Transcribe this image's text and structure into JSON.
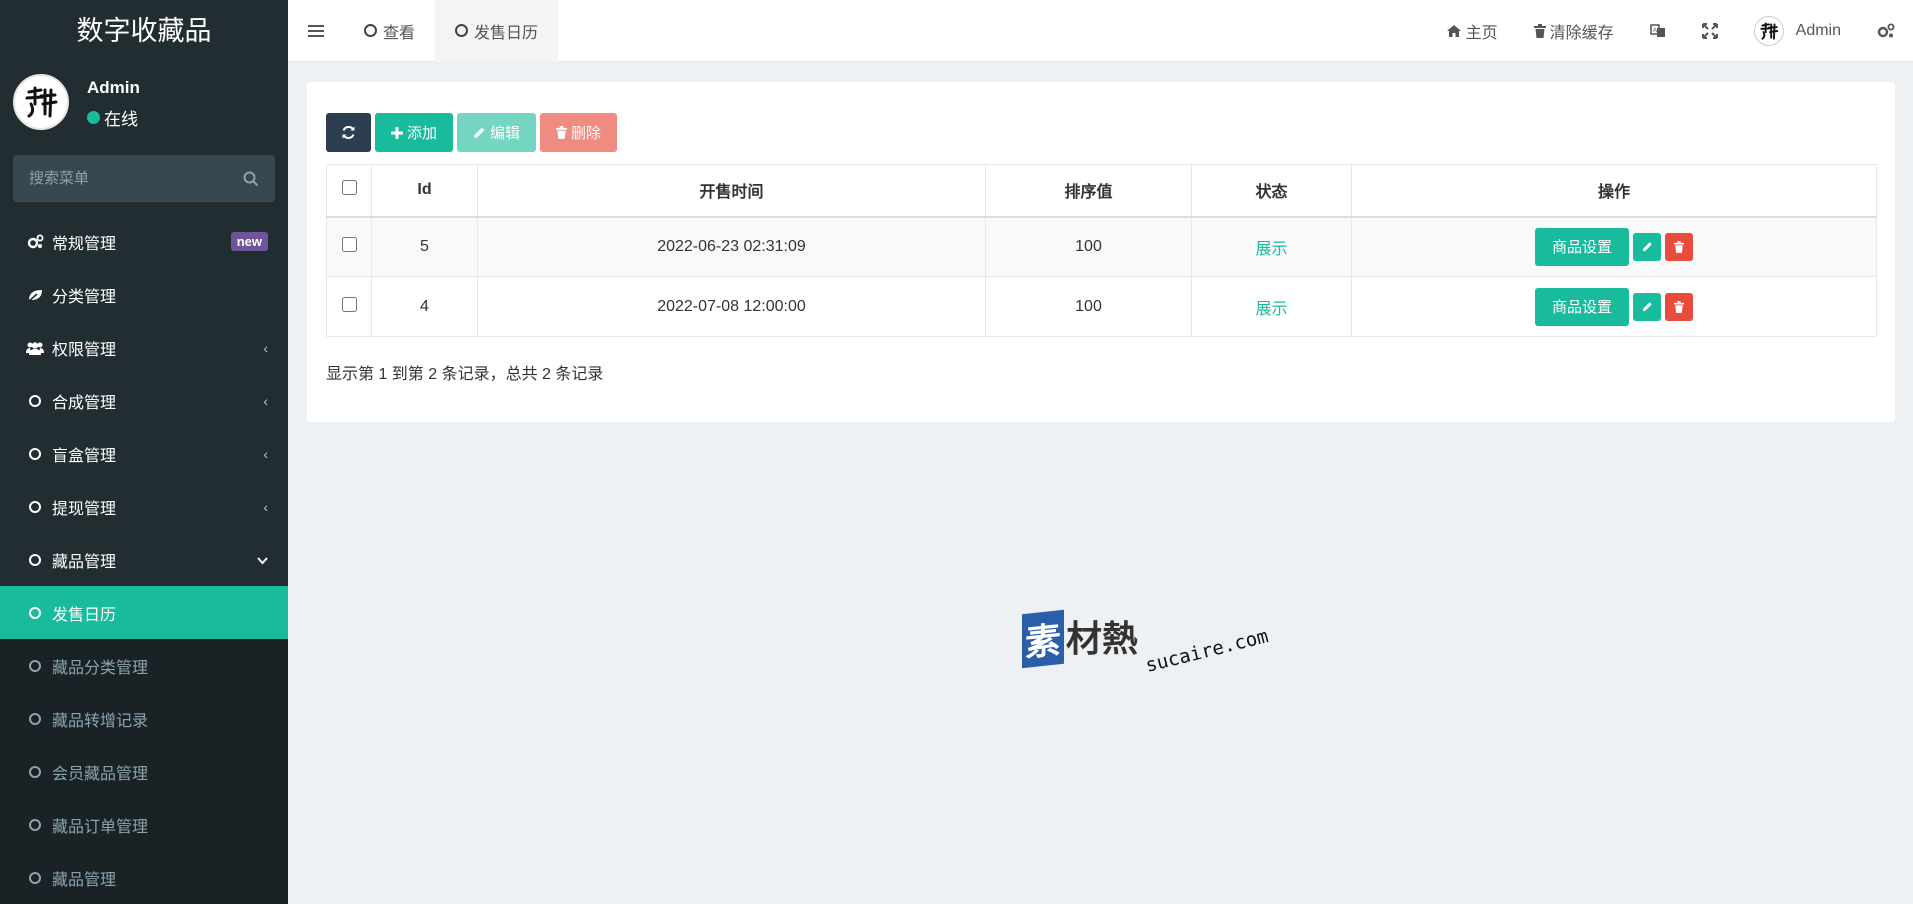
{
  "app": {
    "title": "数字收藏品"
  },
  "user": {
    "name": "Admin",
    "status": "在线"
  },
  "search": {
    "placeholder": "搜索菜单"
  },
  "sidebar": {
    "items": [
      {
        "label": "常规管理",
        "badge": "new"
      },
      {
        "label": "分类管理"
      },
      {
        "label": "权限管理"
      },
      {
        "label": "合成管理"
      },
      {
        "label": "盲盒管理"
      },
      {
        "label": "提现管理"
      },
      {
        "label": "藏品管理"
      }
    ],
    "sub_items": [
      {
        "label": "发售日历"
      },
      {
        "label": "藏品分类管理"
      },
      {
        "label": "藏品转增记录"
      },
      {
        "label": "会员藏品管理"
      },
      {
        "label": "藏品订单管理"
      },
      {
        "label": "藏品管理"
      }
    ]
  },
  "header": {
    "tabs": [
      {
        "label": "查看"
      },
      {
        "label": "发售日历"
      }
    ],
    "home": "主页",
    "clear_cache": "清除缓存",
    "user": "Admin"
  },
  "toolbar": {
    "add": "添加",
    "edit": "编辑",
    "delete": "删除"
  },
  "table": {
    "columns": [
      "Id",
      "开售时间",
      "排序值",
      "状态",
      "操作"
    ],
    "rows": [
      {
        "id": "5",
        "time": "2022-06-23 02:31:09",
        "sort": "100",
        "status": "展示",
        "action": "商品设置"
      },
      {
        "id": "4",
        "time": "2022-07-08 12:00:00",
        "sort": "100",
        "status": "展示",
        "action": "商品设置"
      }
    ]
  },
  "pager": {
    "info": "显示第 1 到第 2 条记录，总共 2 条记录"
  },
  "watermark": {
    "box": "素",
    "text": "材熱",
    "url": "sucaire.com"
  },
  "colors": {
    "accent": "#18bc9c",
    "sidebar": "#222d32",
    "danger": "#e74c3c",
    "dark": "#2c3e50"
  }
}
